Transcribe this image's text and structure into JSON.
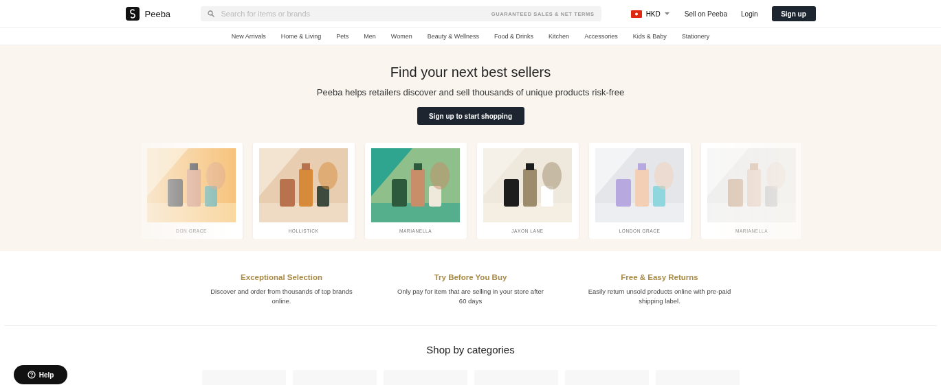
{
  "header": {
    "logo_text": "Peeba",
    "search": {
      "placeholder": "Search for items or brands",
      "tagline": "GUARANTEED SALES & NET TERMS"
    },
    "currency": "HKD",
    "links": [
      "Sell on Peeba",
      "Login"
    ],
    "signup": "Sign up"
  },
  "nav": [
    "New Arrivals",
    "Home & Living",
    "Pets",
    "Men",
    "Women",
    "Beauty & Wellness",
    "Food & Drinks",
    "Kitchen",
    "Accessories",
    "Kids & Baby",
    "Stationery"
  ],
  "hero": {
    "title": "Find your next best sellers",
    "subtitle": "Peeba helps retailers discover and sell thousands of unique products risk-free",
    "button": "Sign up to start shopping",
    "brands": [
      {
        "name": "DON GRACE",
        "kind": "orange"
      },
      {
        "name": "HOLLISTICK",
        "kind": "beige"
      },
      {
        "name": "MARIANELLA",
        "kind": "green"
      },
      {
        "name": "JAXON LANE",
        "kind": "cream"
      },
      {
        "name": "LONDON GRACE",
        "kind": "grey"
      },
      {
        "name": "MARIANELLA",
        "kind": "white"
      }
    ]
  },
  "features": [
    {
      "title": "Exceptional Selection",
      "text": "Discover and order from thousands of top brands online."
    },
    {
      "title": "Try Before You Buy",
      "text": "Only pay for item that are selling in your store after 60 days"
    },
    {
      "title": "Free & Easy Returns",
      "text": "Easily return unsold products online with pre-paid shipping label."
    }
  ],
  "categories": {
    "title": "Shop by categories"
  },
  "help": "Help"
}
